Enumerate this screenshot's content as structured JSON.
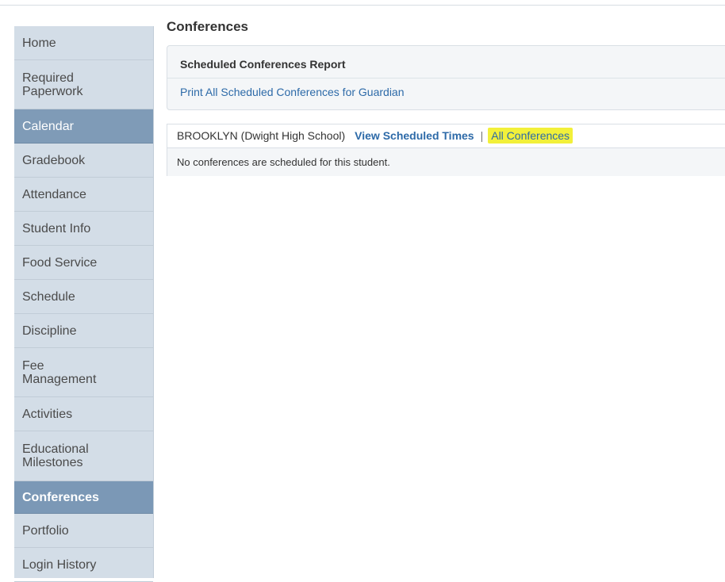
{
  "page": {
    "title": "Conferences"
  },
  "sidebar": {
    "items": [
      {
        "label": "Home",
        "state": "normal"
      },
      {
        "label": "Required Paperwork",
        "state": "normal"
      },
      {
        "label": "Calendar",
        "state": "active"
      },
      {
        "label": "Gradebook",
        "state": "normal"
      },
      {
        "label": "Attendance",
        "state": "normal"
      },
      {
        "label": "Student Info",
        "state": "normal"
      },
      {
        "label": "Food Service",
        "state": "normal"
      },
      {
        "label": "Schedule",
        "state": "normal"
      },
      {
        "label": "Discipline",
        "state": "normal"
      },
      {
        "label": "Fee Management",
        "state": "normal"
      },
      {
        "label": "Activities",
        "state": "normal"
      },
      {
        "label": "Educational Milestones",
        "state": "normal"
      },
      {
        "label": "Conferences",
        "state": "current"
      },
      {
        "label": "Portfolio",
        "state": "normal"
      },
      {
        "label": "Login History",
        "state": "normal"
      }
    ]
  },
  "report": {
    "heading": "Scheduled Conferences Report",
    "link": "Print All Scheduled Conferences for Guardian"
  },
  "student_tab": {
    "school_label": "BROOKLYN (Dwight High School)",
    "view_link": "View Scheduled Times",
    "separator": "|",
    "all_link": "All Conferences",
    "highlight_color": "#f2f03a",
    "empty_message": "No conferences are scheduled for this student."
  },
  "colors": {
    "sidebar_bg": "#d3dde7",
    "sidebar_active": "#7b98b6",
    "link": "#2d6aa8"
  }
}
